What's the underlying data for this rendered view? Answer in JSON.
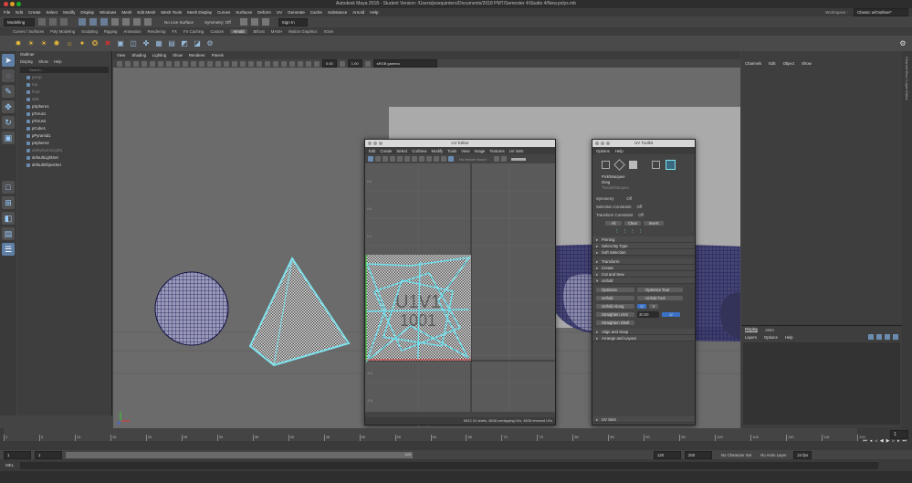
{
  "window": {
    "title": "Autodesk Maya 2018 - Student Version: /Users/jesequintero/Documents/2018 PMT/Semester 4/Studio 4/New.polys.mb"
  },
  "menubar": {
    "items": [
      "File",
      "Edit",
      "Create",
      "Select",
      "Modify",
      "Display",
      "Windows",
      "Mesh",
      "Edit Mesh",
      "Mesh Tools",
      "Mesh Display",
      "Curves",
      "Surfaces",
      "Deform",
      "UV",
      "Generate",
      "Cache",
      "Substance",
      "Arnold",
      "Help"
    ],
    "workspace_label": "Workspace :",
    "workspace_value": "Classic w/Outliner*"
  },
  "statusline": {
    "mode": "Modelling",
    "live_surface": "No Live Surface",
    "symmetry": "Symmetry: Off",
    "sign_in": "Sign In"
  },
  "shelf_tabs": [
    "Curves / Surfaces",
    "Poly Modeling",
    "Sculpting",
    "Rigging",
    "Animation",
    "Rendering",
    "FX",
    "FX Caching",
    "Custom",
    "Arnold",
    "Bifrost",
    "MASH",
    "Motion Graphics",
    "XGen"
  ],
  "shelf_active": "Arnold",
  "outliner": {
    "title": "Outliner",
    "menus": [
      "Display",
      "Show",
      "Help"
    ],
    "search_placeholder": "Search...",
    "items": [
      {
        "label": "persp",
        "dim": true
      },
      {
        "label": "top",
        "dim": true
      },
      {
        "label": "front",
        "dim": true
      },
      {
        "label": "side",
        "dim": true
      },
      {
        "label": "pSphere1",
        "dim": false
      },
      {
        "label": "pTorus1",
        "dim": false
      },
      {
        "label": "pTorus2",
        "dim": false
      },
      {
        "label": "pCube1",
        "dim": false
      },
      {
        "label": "pPyramid1",
        "dim": false
      },
      {
        "label": "pSphere2",
        "dim": false
      },
      {
        "label": "aiSkyDomeLight1",
        "dim": true
      },
      {
        "label": "defaultLightSet",
        "dim": false
      },
      {
        "label": "defaultObjectSet",
        "dim": false
      }
    ]
  },
  "viewport": {
    "menus": [
      "View",
      "Shading",
      "Lighting",
      "Show",
      "Renderer",
      "Panels"
    ],
    "field1": "0.00",
    "field2": "1.00",
    "color_space": "sRGB gamma",
    "label": "persp"
  },
  "uv_editor": {
    "title": "UV Editor",
    "menus": [
      "Edit",
      "Create",
      "Select",
      "Cut/Sew",
      "Modify",
      "Tools",
      "View",
      "Image",
      "Textures",
      "UV Sets"
    ],
    "texture": "No texture found",
    "tile_label_1": "U1V1",
    "tile_label_2": "1001",
    "status": "65/12 UV shells, 45/38 overlapping UVs, 45/36 reversed UVs",
    "v_ticks": [
      "0.8",
      "0.6",
      "0.4",
      "0.2",
      "0",
      "-0.2",
      "-0.4",
      "-0.6",
      "-0.8"
    ]
  },
  "uv_toolkit": {
    "title": "UV Toolkit",
    "menus": [
      "Options",
      "Help"
    ],
    "pick_options": [
      "Pick/Marquee",
      "Drag",
      "Tweak/Marquee"
    ],
    "symmetry_label": "Symmetry",
    "symmetry_value": "Off",
    "selection_constraint_label": "Selection Constraint",
    "selection_constraint_value": "Off",
    "transform_constraint_label": "Transform Constraint",
    "transform_constraint_value": "Off",
    "buttons": [
      "All",
      "Clear",
      "Invert"
    ],
    "sections_top": [
      "Pinning",
      "Select By Type",
      "Soft Selection"
    ],
    "sections_mid": [
      "Transform",
      "Create",
      "Cut and Sew"
    ],
    "unfold_section": "Unfold",
    "unfold": {
      "optimize": "Optimize",
      "optimize_tool": "Optimize Tool",
      "unfold": "Unfold",
      "unfold_tool": "Unfold Tool",
      "unfold_along": "Unfold Along",
      "u": "U",
      "v": "V",
      "straighten_uvs": "Straighten UVs",
      "straighten_value": "30.00",
      "straighten_axis": "U",
      "straighten_shell": "Straighten Shell"
    },
    "sections_bottom": [
      "Align and Snap",
      "Arrange and Layout"
    ],
    "uv_sets": "UV Sets"
  },
  "channel_box": {
    "menus": [
      "Channels",
      "Edit",
      "Object",
      "Show"
    ]
  },
  "layer_editor": {
    "tabs": [
      "Display",
      "Anim"
    ],
    "menus": [
      "Layers",
      "Options",
      "Help"
    ]
  },
  "timeline": {
    "ticks": [
      "1",
      "5",
      "10",
      "15",
      "20",
      "25",
      "30",
      "35",
      "40",
      "45",
      "50",
      "55",
      "60",
      "65",
      "70",
      "75",
      "80",
      "85",
      "90",
      "95",
      "100",
      "105",
      "110",
      "115",
      "120"
    ],
    "current_frame": "1"
  },
  "range": {
    "start": "1",
    "inner_start": "1",
    "inner_end": "120",
    "end_1": "120",
    "end_2": "200",
    "character_set": "No Character Set",
    "anim_layer": "No Anim Layer",
    "fps": "24 fps"
  },
  "mel": {
    "label": "MEL"
  }
}
